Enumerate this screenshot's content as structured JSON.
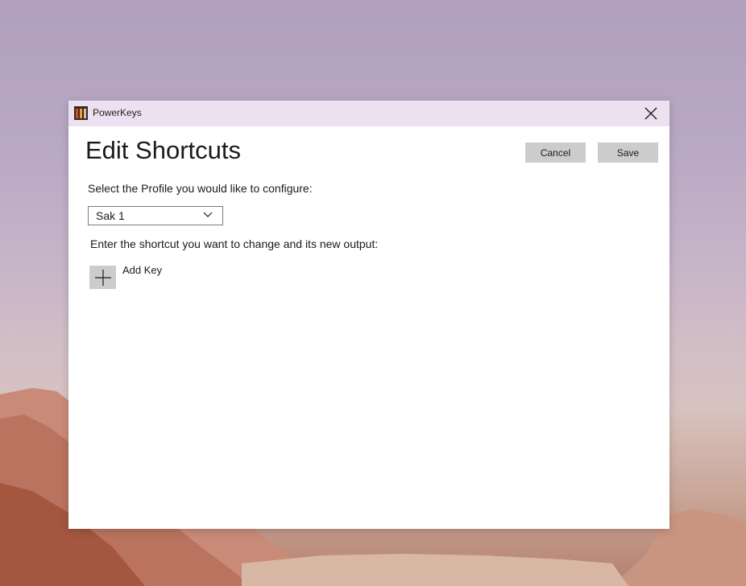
{
  "window": {
    "app_title": "PowerKeys",
    "app_icon": "powerkeys-app-icon",
    "close_icon": "close-icon"
  },
  "page": {
    "title": "Edit Shortcuts"
  },
  "actions": {
    "cancel_label": "Cancel",
    "save_label": "Save"
  },
  "profile": {
    "prompt": "Select the Profile you would like to configure:",
    "selected": "Sak 1",
    "chevron_icon": "chevron-down-icon"
  },
  "shortcuts": {
    "prompt": "Enter the shortcut you want to change and its new output:",
    "add_key_label": "Add Key",
    "add_icon": "plus-icon"
  }
}
